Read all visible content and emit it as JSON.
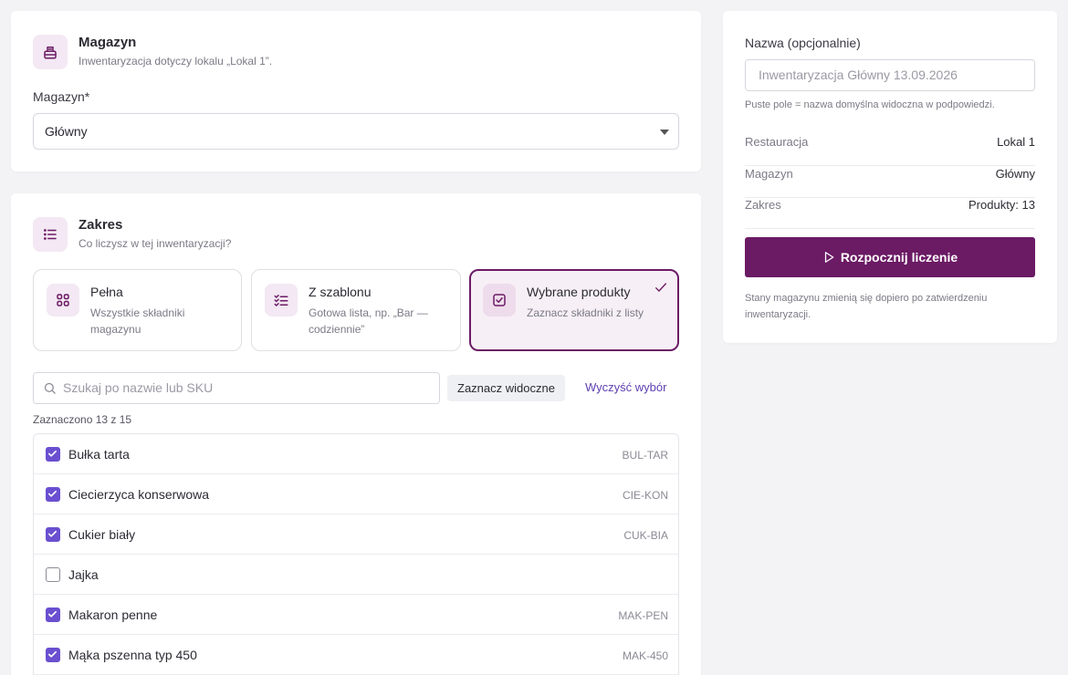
{
  "warehouse_section": {
    "title": "Magazyn",
    "subtitle": "Inwentaryzacja dotyczy lokalu „Lokal 1”.",
    "field_label": "Magazyn*",
    "selected_value": "Główny"
  },
  "scope_section": {
    "title": "Zakres",
    "subtitle": "Co liczysz w tej inwentaryzacji?",
    "modes": [
      {
        "title": "Pełna",
        "description": "Wszystkie składniki magazynu",
        "icon": "grid-icon"
      },
      {
        "title": "Z szablonu",
        "description": "Gotowa lista, np. „Bar — codziennie”",
        "icon": "checklist-icon"
      },
      {
        "title": "Wybrane produkty",
        "description": "Zaznacz składniki z listy",
        "icon": "checkbox-icon",
        "selected": true
      }
    ],
    "search_placeholder": "Szukaj po nazwie lub SKU",
    "select_visible_label": "Zaznacz widoczne",
    "clear_selection_label": "Wyczyść wybór",
    "counter": "Zaznaczono 13 z 15",
    "products": [
      {
        "name": "Bułka tarta",
        "sku": "BUL-TAR",
        "checked": true
      },
      {
        "name": "Ciecierzyca konserwowa",
        "sku": "CIE-KON",
        "checked": true
      },
      {
        "name": "Cukier biały",
        "sku": "CUK-BIA",
        "checked": true
      },
      {
        "name": "Jajka",
        "sku": "",
        "checked": false
      },
      {
        "name": "Makaron penne",
        "sku": "MAK-PEN",
        "checked": true
      },
      {
        "name": "Mąka pszenna typ 450",
        "sku": "MAK-450",
        "checked": true
      }
    ]
  },
  "summary": {
    "name_label": "Nazwa (opcjonalnie)",
    "name_placeholder": "Inwentaryzacja Główny 13.09.2026",
    "name_hint": "Puste pole = nazwa domyślna widoczna w podpowiedzi.",
    "rows": [
      {
        "key": "Restauracja",
        "value": "Lokal 1"
      },
      {
        "key": "Magazyn",
        "value": "Główny"
      },
      {
        "key": "Zakres",
        "value": "Produkty: 13"
      }
    ],
    "start_button": "Rozpocznij liczenie",
    "note": "Stany magazynu zmienią się dopiero po zatwierdzeniu inwentaryzacji."
  },
  "colors": {
    "accent": "#6b1a64",
    "checkbox": "#6a4fd0",
    "link": "#5d3fb0"
  }
}
